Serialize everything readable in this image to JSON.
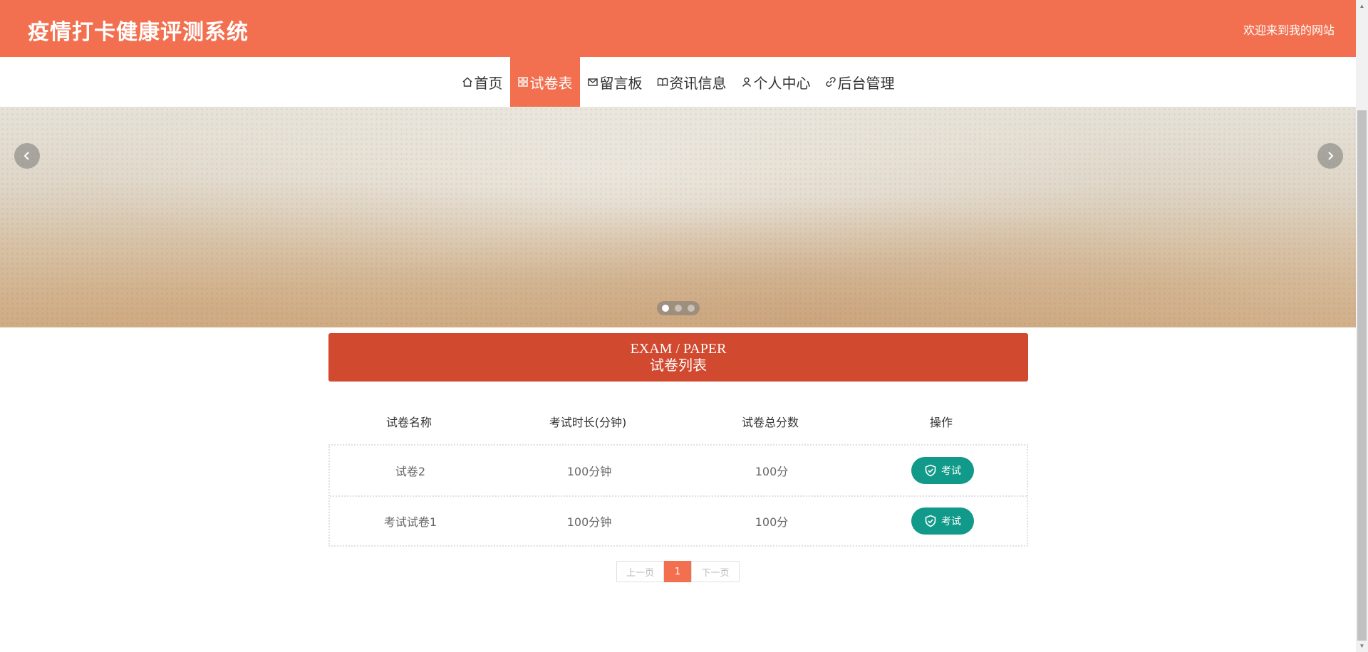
{
  "header": {
    "title": "疫情打卡健康评测系统",
    "welcome": "欢迎来到我的网站"
  },
  "nav": {
    "items": [
      {
        "label": "首页",
        "icon": "home-icon"
      },
      {
        "label": "试卷表",
        "icon": "grid-icon",
        "active": true
      },
      {
        "label": "留言板",
        "icon": "mail-icon"
      },
      {
        "label": "资讯信息",
        "icon": "book-icon"
      },
      {
        "label": "个人中心",
        "icon": "user-icon"
      },
      {
        "label": "后台管理",
        "icon": "link-icon"
      }
    ]
  },
  "banner": {
    "slide_count": 3,
    "active_slide": 1
  },
  "section": {
    "title_en": "EXAM / PAPER",
    "title_cn": "试卷列表"
  },
  "table": {
    "headers": [
      "试卷名称",
      "考试时长(分钟)",
      "试卷总分数",
      "操作"
    ],
    "rows": [
      {
        "name": "试卷2",
        "duration": "100分钟",
        "score": "100分",
        "action": "考试"
      },
      {
        "name": "考试试卷1",
        "duration": "100分钟",
        "score": "100分",
        "action": "考试"
      }
    ]
  },
  "pagination": {
    "prev": "上一页",
    "current": "1",
    "next": "下一页"
  },
  "colors": {
    "primary": "#f2704f",
    "section": "#d14a30",
    "button": "#119a8a"
  }
}
